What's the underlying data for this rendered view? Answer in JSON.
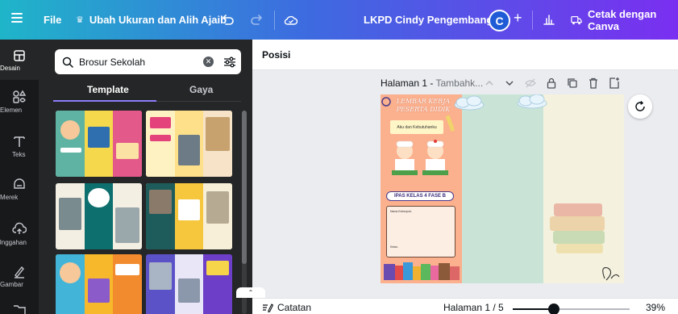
{
  "topbar": {
    "file_label": "File",
    "resize_label": "Ubah Ukuran dan Alih Ajaib",
    "project_title": "LKPD Cindy Pengembangan",
    "avatar_initial": "C",
    "print_label": "Cetak dengan Canva"
  },
  "rail": {
    "items": [
      {
        "label": "Desain",
        "icon": "layout-icon"
      },
      {
        "label": "Elemen",
        "icon": "elements-icon"
      },
      {
        "label": "Teks",
        "icon": "text-icon"
      },
      {
        "label": "Merek",
        "icon": "brand-icon"
      },
      {
        "label": "Unggahan",
        "icon": "upload-icon"
      },
      {
        "label": "Gambar",
        "icon": "draw-icon"
      }
    ]
  },
  "panel": {
    "search_value": "Brosur Sekolah",
    "tabs": [
      "Template",
      "Gaya"
    ]
  },
  "editor": {
    "subbar_label": "Posisi",
    "page_label": "Halaman 1 - ",
    "page_title_placeholder": "Tambahk...",
    "design": {
      "title": "LEMBAR KERJA PESERTA DIDIK",
      "subtitle": "Aku dan Kebutuhanku",
      "badge": "IPAS KELAS 4 FASE B",
      "box_line1": "Nama Kelompok:",
      "box_line2": "Kelas:"
    }
  },
  "bottombar": {
    "notes_label": "Catatan",
    "page_count": "Halaman 1 / 5",
    "zoom_level": "39%",
    "zoom_fraction": 0.35
  }
}
